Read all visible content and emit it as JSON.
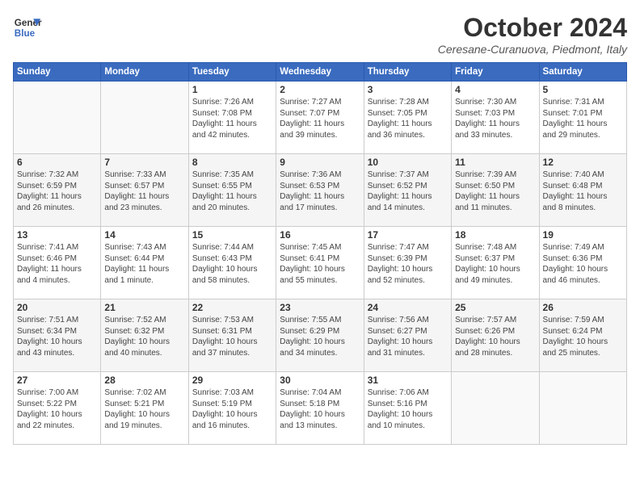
{
  "header": {
    "logo_line1": "General",
    "logo_line2": "Blue",
    "month": "October 2024",
    "location": "Ceresane-Curanuova, Piedmont, Italy"
  },
  "weekdays": [
    "Sunday",
    "Monday",
    "Tuesday",
    "Wednesday",
    "Thursday",
    "Friday",
    "Saturday"
  ],
  "weeks": [
    [
      {
        "day": "",
        "info": ""
      },
      {
        "day": "",
        "info": ""
      },
      {
        "day": "1",
        "info": "Sunrise: 7:26 AM\nSunset: 7:08 PM\nDaylight: 11 hours\nand 42 minutes."
      },
      {
        "day": "2",
        "info": "Sunrise: 7:27 AM\nSunset: 7:07 PM\nDaylight: 11 hours\nand 39 minutes."
      },
      {
        "day": "3",
        "info": "Sunrise: 7:28 AM\nSunset: 7:05 PM\nDaylight: 11 hours\nand 36 minutes."
      },
      {
        "day": "4",
        "info": "Sunrise: 7:30 AM\nSunset: 7:03 PM\nDaylight: 11 hours\nand 33 minutes."
      },
      {
        "day": "5",
        "info": "Sunrise: 7:31 AM\nSunset: 7:01 PM\nDaylight: 11 hours\nand 29 minutes."
      }
    ],
    [
      {
        "day": "6",
        "info": "Sunrise: 7:32 AM\nSunset: 6:59 PM\nDaylight: 11 hours\nand 26 minutes."
      },
      {
        "day": "7",
        "info": "Sunrise: 7:33 AM\nSunset: 6:57 PM\nDaylight: 11 hours\nand 23 minutes."
      },
      {
        "day": "8",
        "info": "Sunrise: 7:35 AM\nSunset: 6:55 PM\nDaylight: 11 hours\nand 20 minutes."
      },
      {
        "day": "9",
        "info": "Sunrise: 7:36 AM\nSunset: 6:53 PM\nDaylight: 11 hours\nand 17 minutes."
      },
      {
        "day": "10",
        "info": "Sunrise: 7:37 AM\nSunset: 6:52 PM\nDaylight: 11 hours\nand 14 minutes."
      },
      {
        "day": "11",
        "info": "Sunrise: 7:39 AM\nSunset: 6:50 PM\nDaylight: 11 hours\nand 11 minutes."
      },
      {
        "day": "12",
        "info": "Sunrise: 7:40 AM\nSunset: 6:48 PM\nDaylight: 11 hours\nand 8 minutes."
      }
    ],
    [
      {
        "day": "13",
        "info": "Sunrise: 7:41 AM\nSunset: 6:46 PM\nDaylight: 11 hours\nand 4 minutes."
      },
      {
        "day": "14",
        "info": "Sunrise: 7:43 AM\nSunset: 6:44 PM\nDaylight: 11 hours\nand 1 minute."
      },
      {
        "day": "15",
        "info": "Sunrise: 7:44 AM\nSunset: 6:43 PM\nDaylight: 10 hours\nand 58 minutes."
      },
      {
        "day": "16",
        "info": "Sunrise: 7:45 AM\nSunset: 6:41 PM\nDaylight: 10 hours\nand 55 minutes."
      },
      {
        "day": "17",
        "info": "Sunrise: 7:47 AM\nSunset: 6:39 PM\nDaylight: 10 hours\nand 52 minutes."
      },
      {
        "day": "18",
        "info": "Sunrise: 7:48 AM\nSunset: 6:37 PM\nDaylight: 10 hours\nand 49 minutes."
      },
      {
        "day": "19",
        "info": "Sunrise: 7:49 AM\nSunset: 6:36 PM\nDaylight: 10 hours\nand 46 minutes."
      }
    ],
    [
      {
        "day": "20",
        "info": "Sunrise: 7:51 AM\nSunset: 6:34 PM\nDaylight: 10 hours\nand 43 minutes."
      },
      {
        "day": "21",
        "info": "Sunrise: 7:52 AM\nSunset: 6:32 PM\nDaylight: 10 hours\nand 40 minutes."
      },
      {
        "day": "22",
        "info": "Sunrise: 7:53 AM\nSunset: 6:31 PM\nDaylight: 10 hours\nand 37 minutes."
      },
      {
        "day": "23",
        "info": "Sunrise: 7:55 AM\nSunset: 6:29 PM\nDaylight: 10 hours\nand 34 minutes."
      },
      {
        "day": "24",
        "info": "Sunrise: 7:56 AM\nSunset: 6:27 PM\nDaylight: 10 hours\nand 31 minutes."
      },
      {
        "day": "25",
        "info": "Sunrise: 7:57 AM\nSunset: 6:26 PM\nDaylight: 10 hours\nand 28 minutes."
      },
      {
        "day": "26",
        "info": "Sunrise: 7:59 AM\nSunset: 6:24 PM\nDaylight: 10 hours\nand 25 minutes."
      }
    ],
    [
      {
        "day": "27",
        "info": "Sunrise: 7:00 AM\nSunset: 5:22 PM\nDaylight: 10 hours\nand 22 minutes."
      },
      {
        "day": "28",
        "info": "Sunrise: 7:02 AM\nSunset: 5:21 PM\nDaylight: 10 hours\nand 19 minutes."
      },
      {
        "day": "29",
        "info": "Sunrise: 7:03 AM\nSunset: 5:19 PM\nDaylight: 10 hours\nand 16 minutes."
      },
      {
        "day": "30",
        "info": "Sunrise: 7:04 AM\nSunset: 5:18 PM\nDaylight: 10 hours\nand 13 minutes."
      },
      {
        "day": "31",
        "info": "Sunrise: 7:06 AM\nSunset: 5:16 PM\nDaylight: 10 hours\nand 10 minutes."
      },
      {
        "day": "",
        "info": ""
      },
      {
        "day": "",
        "info": ""
      }
    ]
  ]
}
